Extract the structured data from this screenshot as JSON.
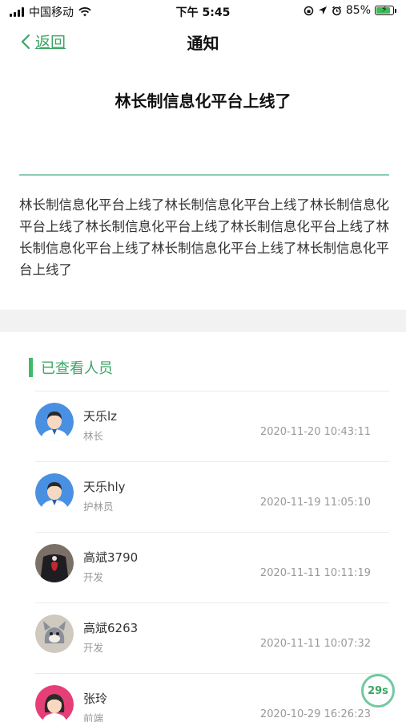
{
  "status_bar": {
    "carrier": "中国移动",
    "time": "下午 5:45",
    "battery_text": "85%",
    "battery_level": 0.85,
    "icons": [
      "signal-icon",
      "wifi-icon",
      "orientation-lock-icon",
      "location-icon",
      "alarm-icon",
      "battery-icon"
    ]
  },
  "nav": {
    "back_label": "返回",
    "title": "通知"
  },
  "notice": {
    "title": "林长制信息化平台上线了",
    "body": "林长制信息化平台上线了林长制信息化平台上线了林长制信息化平台上线了林长制信息化平台上线了林长制信息化平台上线了林长制信息化平台上线了林长制信息化平台上线了林长制信息化平台上线了"
  },
  "viewers": {
    "header": "已查看人员",
    "items": [
      {
        "name": "天乐lz",
        "role": "林长",
        "time": "2020-11-20 10:43:11",
        "avatar": "man-cartoon-avatar"
      },
      {
        "name": "天乐hly",
        "role": "护林员",
        "time": "2020-11-19 11:05:10",
        "avatar": "man-cartoon-avatar"
      },
      {
        "name": "高斌3790",
        "role": "开发",
        "time": "2020-11-11 10:11:19",
        "avatar": "jersey-photo-avatar"
      },
      {
        "name": "高斌6263",
        "role": "开发",
        "time": "2020-11-11 10:07:32",
        "avatar": "cat-cartoon-avatar"
      },
      {
        "name": "张玲",
        "role": "前端",
        "time": "2020-10-29 16:26:23",
        "avatar": "woman-cartoon-avatar"
      }
    ]
  },
  "timer": {
    "label": "29s"
  },
  "colors": {
    "accent": "#3aa564",
    "divider": "#8cccb0",
    "muted": "#999999"
  }
}
